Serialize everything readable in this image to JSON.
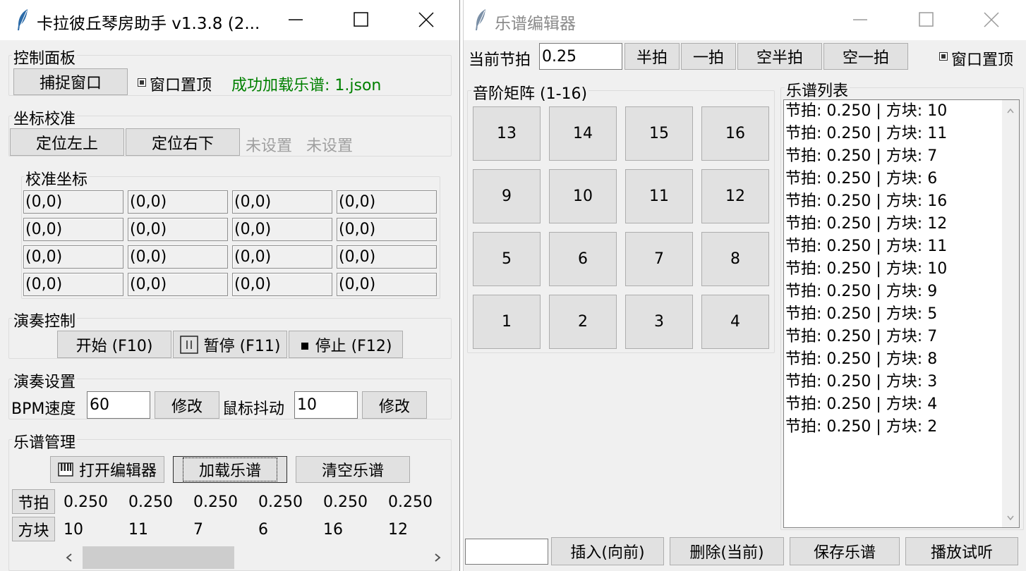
{
  "main_window": {
    "title": "卡拉彼丘琴房助手 v1.3.8 (2...",
    "control_panel": {
      "legend": "控制面板",
      "capture_label": "捕捉窗口",
      "topmost_label": "窗口置顶",
      "status": "成功加载乐谱: 1.json"
    },
    "calibration": {
      "legend": "坐标校准",
      "top_left_label": "定位左上",
      "bottom_right_label": "定位右下",
      "tl_status": "未设置",
      "br_status": "未设置"
    },
    "calib_coords": {
      "legend": "校准坐标",
      "cells": [
        "(0,0)",
        "(0,0)",
        "(0,0)",
        "(0,0)",
        "(0,0)",
        "(0,0)",
        "(0,0)",
        "(0,0)",
        "(0,0)",
        "(0,0)",
        "(0,0)",
        "(0,0)",
        "(0,0)",
        "(0,0)",
        "(0,0)",
        "(0,0)"
      ]
    },
    "play_control": {
      "legend": "演奏控制",
      "start_label": "开始 (F10)",
      "pause_label": "暂停 (F11)",
      "stop_label": "停止 (F12)"
    },
    "play_settings": {
      "legend": "演奏设置",
      "bpm_label": "BPM速度",
      "bpm_value": "60",
      "modify_label": "修改",
      "jitter_label": "鼠标抖动",
      "jitter_value": "10",
      "modify2_label": "修改"
    },
    "score_mgmt": {
      "legend": "乐谱管理",
      "open_editor_label": "打开编辑器",
      "load_label": "加载乐谱",
      "clear_label": "清空乐谱",
      "beat_header": "节拍",
      "block_header": "方块",
      "beats": [
        "0.250",
        "0.250",
        "0.250",
        "0.250",
        "0.250",
        "0.250"
      ],
      "blocks": [
        "10",
        "11",
        "7",
        "6",
        "16",
        "12"
      ]
    }
  },
  "editor_window": {
    "title": "乐谱编辑器",
    "current_beat_label": "当前节拍",
    "current_beat_value": "0.25",
    "half_beat_label": "半拍",
    "one_beat_label": "一拍",
    "empty_half_label": "空半拍",
    "empty_one_label": "空一拍",
    "topmost_label": "窗口置顶",
    "matrix_legend": "音阶矩阵 (1-16)",
    "matrix": [
      "13",
      "14",
      "15",
      "16",
      "9",
      "10",
      "11",
      "12",
      "5",
      "6",
      "7",
      "8",
      "1",
      "2",
      "3",
      "4"
    ],
    "list_legend": "乐谱列表",
    "list_items": [
      "节拍: 0.250 | 方块: 10",
      "节拍: 0.250 | 方块: 11",
      "节拍: 0.250 | 方块: 7",
      "节拍: 0.250 | 方块: 6",
      "节拍: 0.250 | 方块: 16",
      "节拍: 0.250 | 方块: 12",
      "节拍: 0.250 | 方块: 11",
      "节拍: 0.250 | 方块: 10",
      "节拍: 0.250 | 方块: 9",
      "节拍: 0.250 | 方块: 5",
      "节拍: 0.250 | 方块: 7",
      "节拍: 0.250 | 方块: 8",
      "节拍: 0.250 | 方块: 3",
      "节拍: 0.250 | 方块: 4",
      "节拍: 0.250 | 方块: 2"
    ],
    "insert_label": "插入(向前)",
    "delete_label": "删除(当前)",
    "save_label": "保存乐谱",
    "play_label": "播放试听"
  }
}
